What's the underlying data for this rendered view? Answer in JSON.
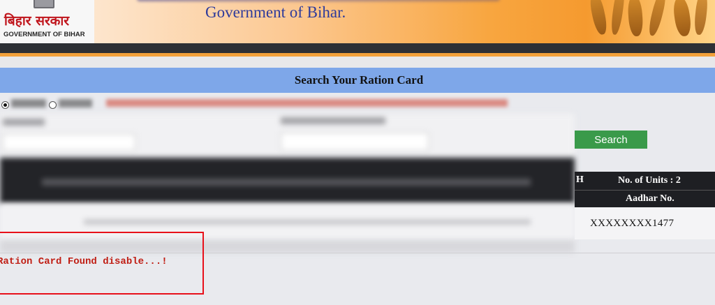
{
  "header": {
    "logo_hindi": "बिहार सरकार",
    "logo_english": "GOVERNMENT OF BIHAR",
    "title": "Government of Bihar."
  },
  "section": {
    "title": "Search Your Ration Card"
  },
  "search_button": "Search",
  "result_table": {
    "partial_header_letter": "H",
    "units_header": "No. of Units : 2",
    "aadhar_header": "Aadhar No.",
    "aadhar_value": "XXXXXXXX1477"
  },
  "status_message": "Ration Card Found disable...!",
  "colors": {
    "section_bar": "#7ea7e9",
    "search_button": "#3a9a4a",
    "message_text": "#c01e14",
    "highlight_box": "#e8101a"
  }
}
